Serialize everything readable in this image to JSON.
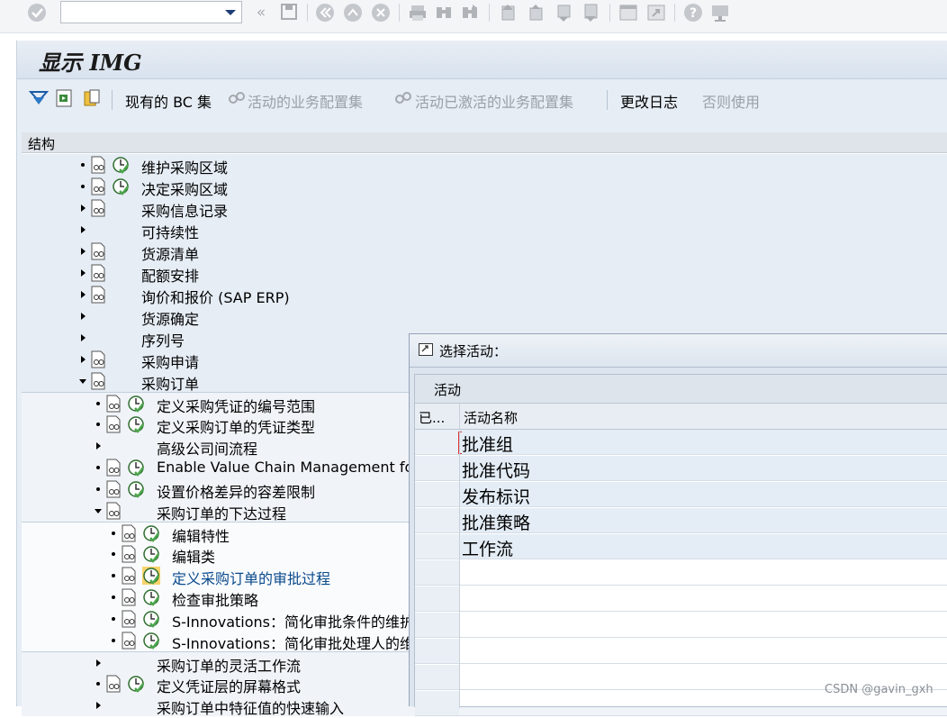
{
  "system_toolbar": {
    "command_field": "",
    "icons": [
      "check-icon",
      "back-arrows-icon",
      "save-icon",
      "back-icon",
      "exit-icon",
      "cancel-icon",
      "print-icon",
      "find-icon",
      "find-next-icon",
      "first-page-icon",
      "prev-page-icon",
      "next-page-icon",
      "last-page-icon",
      "new-session-icon",
      "shortcut-icon",
      "help-icon",
      "layout-icon"
    ]
  },
  "title": "显示 IMG",
  "app_toolbar": {
    "current_bc": "现有的 BC 集",
    "active_bc": "活动的业务配置集",
    "activated_bc": "活动已激活的业务配置集",
    "change_log": "更改日志",
    "release": "否则使用"
  },
  "tree": {
    "header": "结构",
    "rows": [
      {
        "label": "维护采购区域",
        "level": 0,
        "kind": "leaf",
        "doc": true,
        "clock": true
      },
      {
        "label": "决定采购区域",
        "level": 0,
        "kind": "leaf",
        "doc": true,
        "clock": true
      },
      {
        "label": "采购信息记录",
        "level": 0,
        "kind": "expand",
        "doc": true,
        "clock": false
      },
      {
        "label": "可持续性",
        "level": 0,
        "kind": "expand",
        "doc": false,
        "clock": false
      },
      {
        "label": "货源清单",
        "level": 0,
        "kind": "expand",
        "doc": true,
        "clock": false
      },
      {
        "label": "配额安排",
        "level": 0,
        "kind": "expand",
        "doc": true,
        "clock": false
      },
      {
        "label": "询价和报价 (SAP ERP)",
        "level": 0,
        "kind": "expand",
        "doc": true,
        "clock": false
      },
      {
        "label": "货源确定",
        "level": 0,
        "kind": "expand",
        "doc": false,
        "clock": false
      },
      {
        "label": "序列号",
        "level": 0,
        "kind": "expand",
        "doc": false,
        "clock": false
      },
      {
        "label": "采购申请",
        "level": 0,
        "kind": "expand",
        "doc": true,
        "clock": false
      },
      {
        "label": "采购订单",
        "level": 0,
        "kind": "collapse",
        "doc": true,
        "clock": false
      },
      {
        "label": "定义采购凭证的编号范围",
        "level": 1,
        "kind": "leaf",
        "doc": true,
        "clock": true
      },
      {
        "label": "定义采购订单的凭证类型",
        "level": 1,
        "kind": "leaf",
        "doc": true,
        "clock": true
      },
      {
        "label": "高级公司间流程",
        "level": 1,
        "kind": "expand",
        "doc": false,
        "clock": false
      },
      {
        "label": "Enable Value Chain Management for P",
        "level": 1,
        "kind": "leaf",
        "doc": true,
        "clock": true
      },
      {
        "label": "设置价格差异的容差限制",
        "level": 1,
        "kind": "leaf",
        "doc": true,
        "clock": true
      },
      {
        "label": "采购订单的下达过程",
        "level": 1,
        "kind": "collapse",
        "doc": true,
        "clock": false
      },
      {
        "label": "编辑特性",
        "level": 2,
        "kind": "leaf",
        "doc": true,
        "clock": true
      },
      {
        "label": "编辑类",
        "level": 2,
        "kind": "leaf",
        "doc": true,
        "clock": true
      },
      {
        "label": "定义采购订单的审批过程",
        "level": 2,
        "kind": "leaf",
        "doc": true,
        "clock": true,
        "selected": true
      },
      {
        "label": "检查审批策略",
        "level": 2,
        "kind": "leaf",
        "doc": true,
        "clock": true
      },
      {
        "label": "S-Innovations：简化审批条件的维护",
        "level": 2,
        "kind": "leaf",
        "doc": true,
        "clock": true
      },
      {
        "label": "S-Innovations：简化审批处理人的维",
        "level": 2,
        "kind": "leaf",
        "doc": true,
        "clock": true
      },
      {
        "label": "采购订单的灵活工作流",
        "level": 1,
        "kind": "expand",
        "doc": false,
        "clock": false
      },
      {
        "label": "定义凭证层的屏幕格式",
        "level": 1,
        "kind": "leaf",
        "doc": true,
        "clock": true
      },
      {
        "label": "采购订单中特征值的快速输入",
        "level": 1,
        "kind": "expand",
        "doc": false,
        "clock": false
      }
    ]
  },
  "dialog": {
    "title": "选择活动：",
    "caption": "活动",
    "col_done": "已...",
    "col_name": "活动名称",
    "rows": [
      "批准组",
      "批准代码",
      "发布标识",
      "批准策略",
      "工作流"
    ]
  },
  "watermark": "CSDN @gavin_gxh"
}
